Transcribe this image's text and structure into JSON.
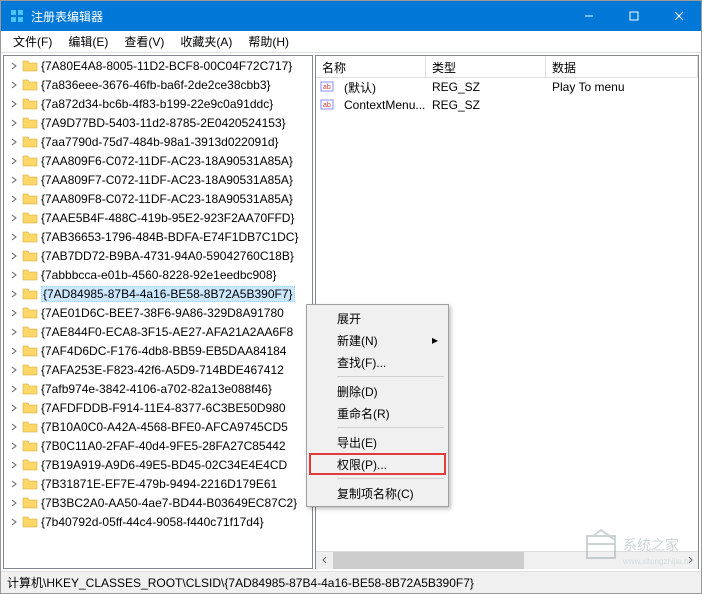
{
  "window": {
    "title": "注册表编辑器"
  },
  "menu": {
    "file": "文件(F)",
    "edit": "编辑(E)",
    "view": "查看(V)",
    "favorites": "收藏夹(A)",
    "help": "帮助(H)"
  },
  "tree": {
    "items": [
      "{7A80E4A8-8005-11D2-BCF8-00C04F72C717}",
      "{7a836eee-3676-46fb-ba6f-2de2ce38cbb3}",
      "{7a872d34-bc6b-4f83-b199-22e9c0a91ddc}",
      "{7A9D77BD-5403-11d2-8785-2E0420524153}",
      "{7aa7790d-75d7-484b-98a1-3913d022091d}",
      "{7AA809F6-C072-11DF-AC23-18A90531A85A}",
      "{7AA809F7-C072-11DF-AC23-18A90531A85A}",
      "{7AA809F8-C072-11DF-AC23-18A90531A85A}",
      "{7AAE5B4F-488C-419b-95E2-923F2AA70FFD}",
      "{7AB36653-1796-484B-BDFA-E74F1DB7C1DC}",
      "{7AB7DD72-B9BA-4731-94A0-59042760C18B}",
      "{7abbbcca-e01b-4560-8228-92e1eedbc908}",
      "{7AD84985-87B4-4a16-BE58-8B72A5B390F7}",
      "{7AE01D6C-BEE7-38F6-9A86-329D8A91780",
      "{7AE844F0-ECA8-3F15-AE27-AFA21A2AA6F8",
      "{7AF4D6DC-F176-4db8-BB59-EB5DAA84184",
      "{7AFA253E-F823-42f6-A5D9-714BDE467412",
      "{7afb974e-3842-4106-a702-82a13e088f46}",
      "{7AFDFDDB-F914-11E4-8377-6C3BE50D980",
      "{7B10A0C0-A42A-4568-BFE0-AFCA9745CD5",
      "{7B0C11A0-2FAF-40d4-9FE5-28FA27C85442",
      "{7B19A919-A9D6-49E5-BD45-02C34E4E4CD",
      "{7B31871E-EF7E-479b-9494-2216D179E61",
      "{7B3BC2A0-AA50-4ae7-BD44-B03649EC87C2}",
      "{7b40792d-05ff-44c4-9058-f440c71f17d4}"
    ],
    "selectedIndex": 12
  },
  "list": {
    "columns": {
      "name": "名称",
      "type": "类型",
      "data": "数据"
    },
    "rows": [
      {
        "name": "(默认)",
        "type": "REG_SZ",
        "data": "Play To menu"
      },
      {
        "name": "ContextMenu...",
        "type": "REG_SZ",
        "data": ""
      }
    ]
  },
  "contextMenu": {
    "expand": "展开",
    "new": "新建(N)",
    "find": "查找(F)...",
    "delete": "删除(D)",
    "rename": "重命名(R)",
    "export": "导出(E)",
    "permissions": "权限(P)...",
    "copyKeyName": "复制项名称(C)"
  },
  "statusbar": {
    "path": "计算机\\HKEY_CLASSES_ROOT\\CLSID\\{7AD84985-87B4-4a16-BE58-8B72A5B390F7}"
  },
  "watermark": "系统之家"
}
